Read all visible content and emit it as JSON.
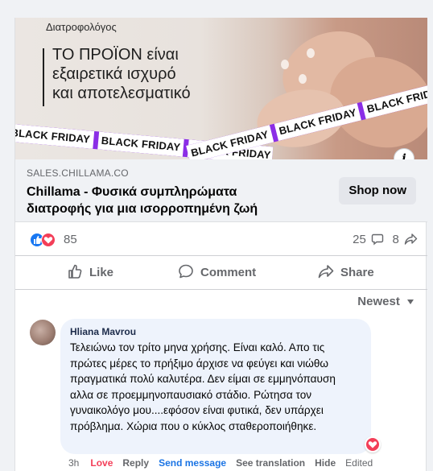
{
  "ad": {
    "brand_label": "Διατροφολόγος",
    "quote_lines": [
      "ΤΟ ΠΡΟΪΟΝ είναι",
      "εξαιρετικά ισχυρό",
      "και αποτελεσματικό"
    ],
    "band_text": "BLACK FRIDAY",
    "info_icon": "info-icon"
  },
  "link": {
    "domain": "SALES.CHILLAMA.CO",
    "title": "Chillama - Φυσικά συμπληρώματα διατροφής για μια ισορροπημένη ζωή",
    "cta": "Shop now"
  },
  "reactions": {
    "total": "85",
    "comments": "25",
    "shares": "8"
  },
  "actions": {
    "like": "Like",
    "comment": "Comment",
    "share": "Share"
  },
  "sort": {
    "label": "Newest"
  },
  "comment": {
    "author": "Hliana Mavrou",
    "text": "Τελειώνω τον τρίτο μηνα χρήσης. Είναι καλό. Απο τις πρώτες μέρες το πρήξιμο άρχισε να φεύγει και νιώθω πραγματικά πολύ καλυτέρα. Δεν είμαι σε εμμηνόπαυση αλλα σε προεμμηνοπαυσιακό στάδιο. Ρώτησα τον γυναικολόγο μου....εφόσον είναι φυτικά, δεν υπάρχει πρόβλημα. Χώρια που ο κύκλος σταθεροποιήθηκε.",
    "time": "3h",
    "love": "Love",
    "reply": "Reply",
    "send_message": "Send message",
    "see_translation": "See translation",
    "hide": "Hide",
    "edited": "Edited"
  },
  "colors": {
    "accent": "#1877f2",
    "love": "#f33e58",
    "band": "#8b2ee6",
    "link_blue": "#1b74e4"
  }
}
